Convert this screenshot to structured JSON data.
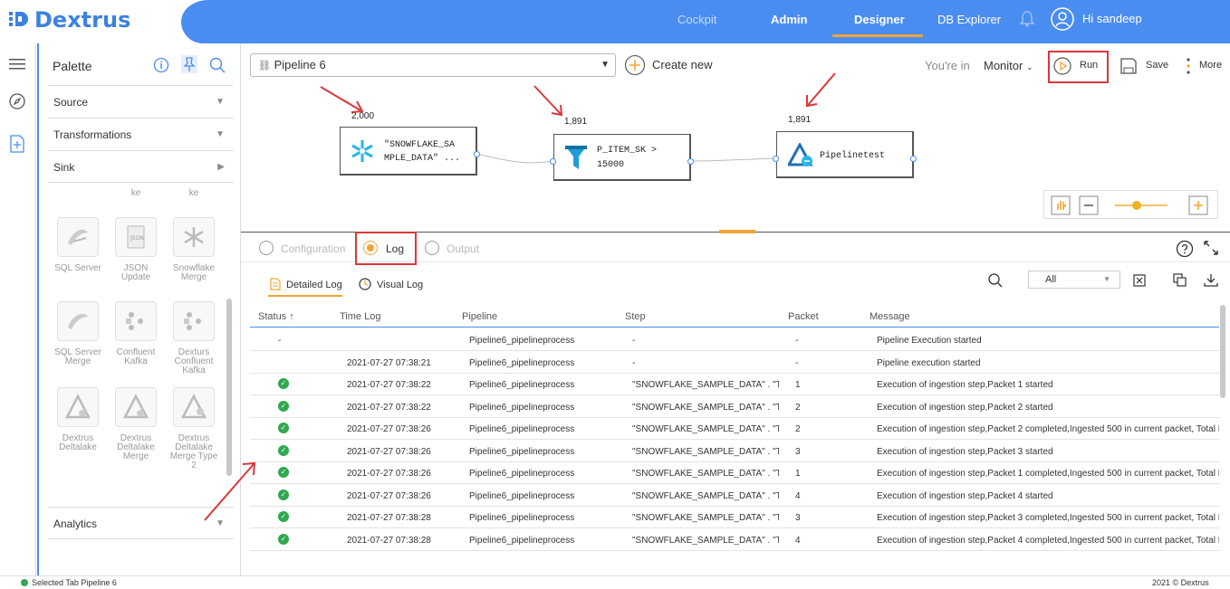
{
  "header": {
    "brand": "Dextrus",
    "nav": [
      "Cockpit",
      "Admin",
      "Designer",
      "DB Explorer"
    ],
    "active_nav": "Designer",
    "greeting": "Hi sandeep"
  },
  "palette": {
    "title": "Palette",
    "sections": [
      {
        "label": "Source"
      },
      {
        "label": "Transformations"
      },
      {
        "label": "Sink"
      },
      {
        "label": "Analytics"
      }
    ],
    "partial_labels": [
      "ke",
      "ke"
    ],
    "tiles": [
      {
        "label": "SQL Server",
        "icon": "sql-server-icon"
      },
      {
        "label": "JSON Update",
        "icon": "json-icon"
      },
      {
        "label": "Snowflake Merge",
        "icon": "snowflake-icon"
      },
      {
        "label": "SQL Server Merge",
        "icon": "sql-server-icon"
      },
      {
        "label": "Confluent Kafka",
        "icon": "kafka-icon"
      },
      {
        "label": "Dexturs Confluent Kafka",
        "icon": "kafka-icon"
      },
      {
        "label": "Dextrus Deltalake",
        "icon": "deltalake-icon"
      },
      {
        "label": "Dextrus Deltalake Merge",
        "icon": "deltalake-icon"
      },
      {
        "label": "Dextrus Deltalake Merge Type 2",
        "icon": "deltalake-icon"
      }
    ]
  },
  "toolbar": {
    "pipeline_name": "Pipeline 6",
    "create_new": "Create new",
    "youre_in": "You're in",
    "mode": "Monitor",
    "run": "Run",
    "save": "Save",
    "more": "More"
  },
  "canvas": {
    "nodes": [
      {
        "label": "\"SNOWFLAKE_SAMPLE_DATA\" ...",
        "line1": "\"SNOWFLAKE_SA",
        "line2": "MPLE_DATA\" ...",
        "count": "2,000",
        "icon": "snowflake-icon"
      },
      {
        "label": "P_ITEM_SK > 15000",
        "line1": "P_ITEM_SK >",
        "line2": "15000",
        "count": "1,891",
        "icon": "filter-icon"
      },
      {
        "label": "Pipelinetest",
        "line1": "Pipelinetest",
        "line2": "",
        "count": "1,891",
        "icon": "deltalake-icon"
      }
    ]
  },
  "bottom_tabs": {
    "tabs": [
      "Configuration",
      "Log",
      "Output"
    ],
    "active": "Log"
  },
  "log": {
    "subtabs": [
      "Detailed Log",
      "Visual Log"
    ],
    "filter": "All",
    "columns": [
      "Status",
      "Time Log",
      "Pipeline",
      "Step",
      "Packet",
      "Message"
    ],
    "rows": [
      {
        "status": "-",
        "time": "",
        "pipeline": "Pipeline6_pipelineprocess",
        "step": "-",
        "packet": "-",
        "message": "Pipeline Execution started"
      },
      {
        "status": "",
        "time": "2021-07-27 07:38:21",
        "pipeline": "Pipeline6_pipelineprocess",
        "step": "-",
        "packet": "-",
        "message": "Pipeline execution started"
      },
      {
        "status": "ok",
        "time": "2021-07-27 07:38:22",
        "pipeline": "Pipeline6_pipelineprocess",
        "step": "\"SNOWFLAKE_SAMPLE_DATA\" . \"T...",
        "packet": "1",
        "message": "Execution of ingestion step,Packet 1 started"
      },
      {
        "status": "ok",
        "time": "2021-07-27 07:38:22",
        "pipeline": "Pipeline6_pipelineprocess",
        "step": "\"SNOWFLAKE_SAMPLE_DATA\" . \"T...",
        "packet": "2",
        "message": "Execution of ingestion step,Packet 2 started"
      },
      {
        "status": "ok",
        "time": "2021-07-27 07:38:26",
        "pipeline": "Pipeline6_pipelineprocess",
        "step": "\"SNOWFLAKE_SAMPLE_DATA\" . \"T...",
        "packet": "2",
        "message": "Execution of ingestion step,Packet 2 completed,Ingested 500 in current packet, Total R"
      },
      {
        "status": "ok",
        "time": "2021-07-27 07:38:26",
        "pipeline": "Pipeline6_pipelineprocess",
        "step": "\"SNOWFLAKE_SAMPLE_DATA\" . \"T...",
        "packet": "3",
        "message": "Execution of ingestion step,Packet 3 started"
      },
      {
        "status": "ok",
        "time": "2021-07-27 07:38:26",
        "pipeline": "Pipeline6_pipelineprocess",
        "step": "\"SNOWFLAKE_SAMPLE_DATA\" . \"T...",
        "packet": "1",
        "message": "Execution of ingestion step,Packet 1 completed,Ingested 500 in current packet, Total R"
      },
      {
        "status": "ok",
        "time": "2021-07-27 07:38:26",
        "pipeline": "Pipeline6_pipelineprocess",
        "step": "\"SNOWFLAKE_SAMPLE_DATA\" . \"T...",
        "packet": "4",
        "message": "Execution of ingestion step,Packet 4 started"
      },
      {
        "status": "ok",
        "time": "2021-07-27 07:38:28",
        "pipeline": "Pipeline6_pipelineprocess",
        "step": "\"SNOWFLAKE_SAMPLE_DATA\" . \"T...",
        "packet": "3",
        "message": "Execution of ingestion step,Packet 3 completed,Ingested 500 in current packet, Total R"
      },
      {
        "status": "ok",
        "time": "2021-07-27 07:38:28",
        "pipeline": "Pipeline6_pipelineprocess",
        "step": "\"SNOWFLAKE_SAMPLE_DATA\" . \"T...",
        "packet": "4",
        "message": "Execution of ingestion step,Packet 4 completed,Ingested 500 in current packet, Total R"
      }
    ]
  },
  "footer": {
    "status": "Selected Tab Pipeline 6",
    "copyright": "2021 © Dextrus"
  },
  "colors": {
    "brand_blue": "#4a8df0",
    "accent_orange": "#f2a535",
    "annotation_red": "#d9383a",
    "ok_green": "#2fa84f"
  }
}
